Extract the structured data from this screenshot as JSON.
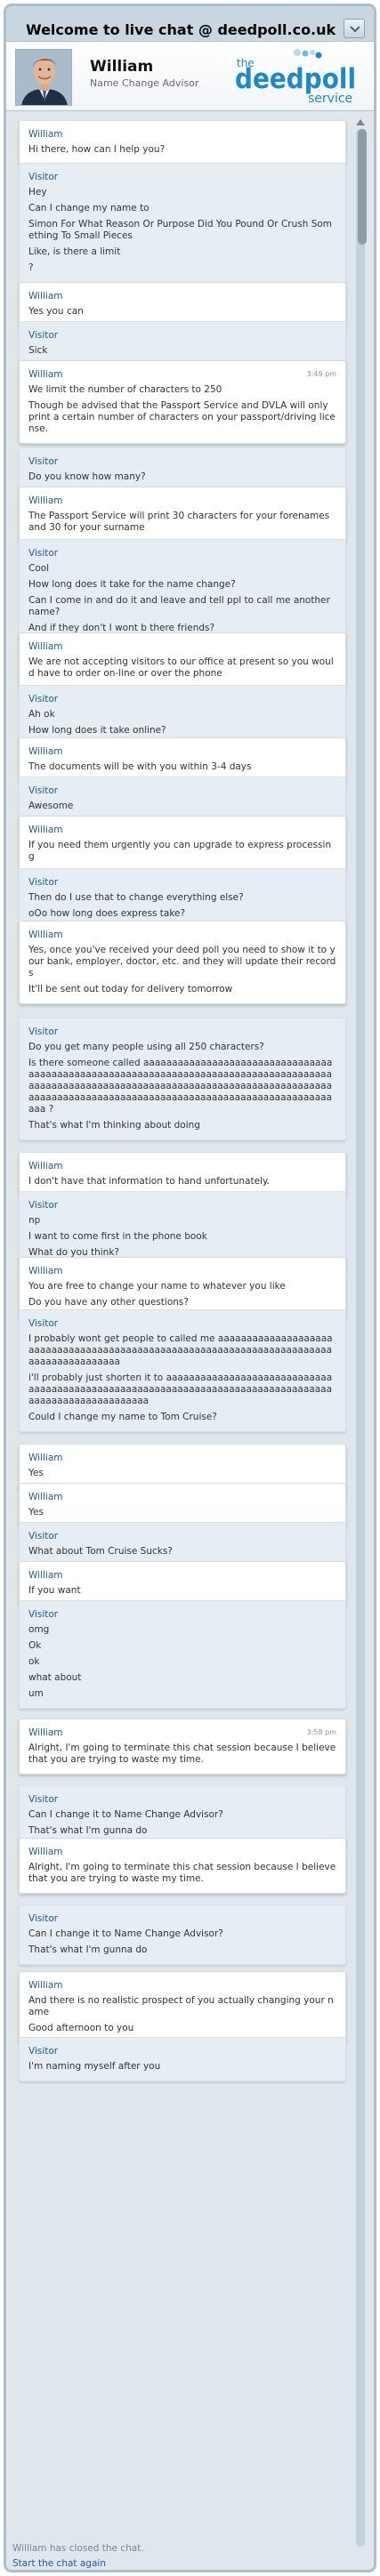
{
  "header": {
    "title": "Welcome to live chat @ deedpoll.co.uk"
  },
  "agent": {
    "name": "William",
    "role": "Name Change Advisor"
  },
  "logo": {
    "prefix": "the",
    "main": "deedpoll",
    "suffix": "service",
    "color": "#1e88c8",
    "dot_colors": [
      "#1e88c8",
      "#7ab6dc",
      "#b8d6ea"
    ]
  },
  "colors": {
    "sender": "#1f5b94",
    "agent_bg": "#ffffff",
    "visitor_bg": "#e6edf3",
    "frame": "#aebfcc"
  },
  "messages": [
    {
      "sender": "William",
      "role": "agent",
      "lines": [
        "Hi there, how can I help you?"
      ]
    },
    {
      "sender": "Visitor",
      "role": "visitor",
      "lines": [
        "Hey",
        "Can I change my name to",
        "Simon For What Reason Or Purpose Did You Pound Or Crush Something To Small Pieces",
        "Like, is there a limit",
        "?"
      ]
    },
    {
      "sender": "William",
      "role": "agent",
      "lines": [
        "Yes you can"
      ]
    },
    {
      "sender": "Visitor",
      "role": "visitor",
      "lines": [
        "Sick"
      ]
    },
    {
      "sender": "William",
      "role": "agent",
      "time": "3:49 pm",
      "lines": [
        "We limit the number of characters to 250",
        "Though be advised that the Passport Service and DVLA will only print a certain number of characters on your passport/driving license."
      ]
    },
    {
      "sender": "Visitor",
      "role": "visitor",
      "lines": [
        "Do you know how many?"
      ]
    },
    {
      "sender": "William",
      "role": "agent",
      "lines": [
        "The Passport Service will print 30 characters for your forenames and 30 for your surname"
      ]
    },
    {
      "sender": "Visitor",
      "role": "visitor",
      "lines": [
        "Cool",
        "How long does it take for the name change?",
        "Can I come in and do it and leave and tell ppl to call me another name?",
        "And if they don't I wont b there friends?"
      ]
    },
    {
      "sender": "William",
      "role": "agent",
      "lines": [
        "We are not accepting visitors to our office at present so you would have to order on-line or over the phone"
      ]
    },
    {
      "sender": "Visitor",
      "role": "visitor",
      "lines": [
        "Ah ok",
        "How long does it take online?"
      ]
    },
    {
      "sender": "William",
      "role": "agent",
      "lines": [
        "The documents will be with you within 3-4 days"
      ]
    },
    {
      "sender": "Visitor",
      "role": "visitor",
      "lines": [
        "Awesome"
      ]
    },
    {
      "sender": "William",
      "role": "agent",
      "lines": [
        "If you need them urgently you can upgrade to express processing"
      ]
    },
    {
      "sender": "Visitor",
      "role": "visitor",
      "lines": [
        "Then do I use that to change everything else?",
        "oOo how long does express take?"
      ]
    },
    {
      "sender": "William",
      "role": "agent",
      "lines": [
        "Yes, once you've received your deed poll you need to show it to your bank, employer, doctor, etc. and they will update their records",
        "It'll be sent out today for delivery tomorrow"
      ]
    },
    {
      "sender": "Visitor",
      "role": "visitor",
      "lines": [
        "Do you get many people using all 250 characters?",
        "Is there someone called aaaaaaaaaaaaaaaaaaaaaaaaaaaaaaaaaaaaaaaaaaaaaaaaaaaaaaaaaaaaaaaaaaaaaaaaaaaaaaaaaaaaaaaaaaaaaaaaaaaaaaaaaaaaaaaaaaaaaaaaaaaaaaaaaaaaaaaaaaaaaaaaaaaaaaaaaaaaaaaaaaaaaaaaaaaaaaaaaaaaaaaaaaaaaaaaaaa ?",
        "That's what I'm thinking about doing"
      ]
    },
    {
      "sender": "William",
      "role": "agent",
      "lines": [
        "I don't have that information to hand unfortunately."
      ]
    },
    {
      "sender": "Visitor",
      "role": "visitor",
      "lines": [
        "np",
        "I want to come first in the phone book",
        "What do you think?"
      ]
    },
    {
      "sender": "William",
      "role": "agent",
      "lines": [
        "You are free to change your name to whatever you like",
        "Do you have any other questions?"
      ]
    },
    {
      "sender": "Visitor",
      "role": "visitor",
      "lines": [
        "I probably wont get people to called me aaaaaaaaaaaaaaaaaaaaaaaaaaaaaaaaaaaaaaaaaaaaaaaaaaaaaaaaaaaaaaaaaaaaaaaaaaaaaaaaaaaaaaaaa",
        "i'll probably just shorten it to aaaaaaaaaaaaaaaaaaaaaaaaaaaaaaaaaaaaaaaaaaaaaaaaaaaaaaaaaaaaaaaaaaaaaaaaaaaaaaaaaaaaaaaaaaaaaaaaaaaaaaa",
        "Could I change my name to Tom Cruise?"
      ]
    },
    {
      "sender": "William",
      "role": "agent",
      "lines": [
        "Yes"
      ]
    },
    {
      "sender": "William",
      "role": "agent",
      "lines": [
        "Yes"
      ]
    },
    {
      "sender": "Visitor",
      "role": "visitor",
      "lines": [
        "What about Tom Cruise Sucks?"
      ]
    },
    {
      "sender": "William",
      "role": "agent",
      "lines": [
        "If you want"
      ]
    },
    {
      "sender": "Visitor",
      "role": "visitor",
      "lines": [
        "omg",
        "Ok",
        "ok",
        "what about",
        "um"
      ]
    },
    {
      "sender": "William",
      "role": "agent",
      "time": "3:58 pm",
      "lines": [
        "Alright, I'm going to terminate this chat session because I believe that you are trying to waste my time."
      ]
    },
    {
      "sender": "Visitor",
      "role": "visitor",
      "lines": [
        "Can I change it to Name Change Advisor?",
        "That's what I'm gunna do"
      ]
    },
    {
      "sender": "William",
      "role": "agent",
      "lines": [
        "Alright, I'm going to terminate this chat session because I believe that you are trying to waste my time."
      ]
    },
    {
      "sender": "Visitor",
      "role": "visitor",
      "lines": [
        "Can I change it to Name Change Advisor?",
        "That's what I'm gunna do"
      ]
    },
    {
      "sender": "William",
      "role": "agent",
      "lines": [
        "And there is no realistic prospect of you actually changing your name",
        "Good afternoon to you"
      ]
    },
    {
      "sender": "Visitor",
      "role": "visitor",
      "lines": [
        "I'm naming myself after you"
      ]
    }
  ],
  "footer": {
    "closed_note": "William has closed the chat.",
    "restart_link": "Start the chat again"
  }
}
